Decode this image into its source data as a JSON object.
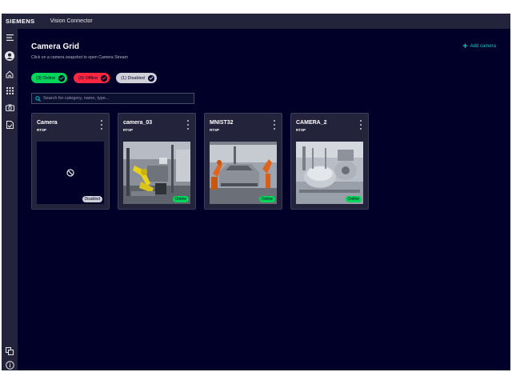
{
  "header": {
    "brand": "SIEMENS",
    "app_title": "Vision Connector"
  },
  "sidebar": {
    "icons": [
      "menu-icon",
      "user-icon",
      "home-icon",
      "apps-icon",
      "camera-icon",
      "document-icon",
      "language-icon",
      "info-icon"
    ]
  },
  "page": {
    "title": "Camera Grid",
    "subtitle": "Click on a camera snapshot to open Camera Stream",
    "add_camera_label": "Add camera"
  },
  "filters": [
    {
      "label": "(3) Online",
      "color": "#01d65a"
    },
    {
      "label": "(0) Offline",
      "color": "#ff2640"
    },
    {
      "label": "(1) Disabled",
      "color": "#d0d0d8"
    }
  ],
  "search": {
    "placeholder": "Search for category, name, type...",
    "value": ""
  },
  "cameras": [
    {
      "name": "Camera",
      "protocol": "RTSP",
      "status": "Disabled",
      "thumbnail": "no-image-icon"
    },
    {
      "name": "camera_03",
      "protocol": "RTSP",
      "status": "Online",
      "thumbnail": "robot-cell-photo"
    },
    {
      "name": "MNIST32",
      "protocol": "RTSP",
      "status": "Online",
      "thumbnail": "car-assembly-photo"
    },
    {
      "name": "CAMERA_2",
      "protocol": "RTSP",
      "status": "Online",
      "thumbnail": "bottling-machine-photo"
    }
  ],
  "colors": {
    "background": "#000028",
    "panel": "#23233c",
    "accent": "#00cccc",
    "online": "#01d65a",
    "offline": "#ff2640",
    "disabled": "#d0d0d8"
  }
}
